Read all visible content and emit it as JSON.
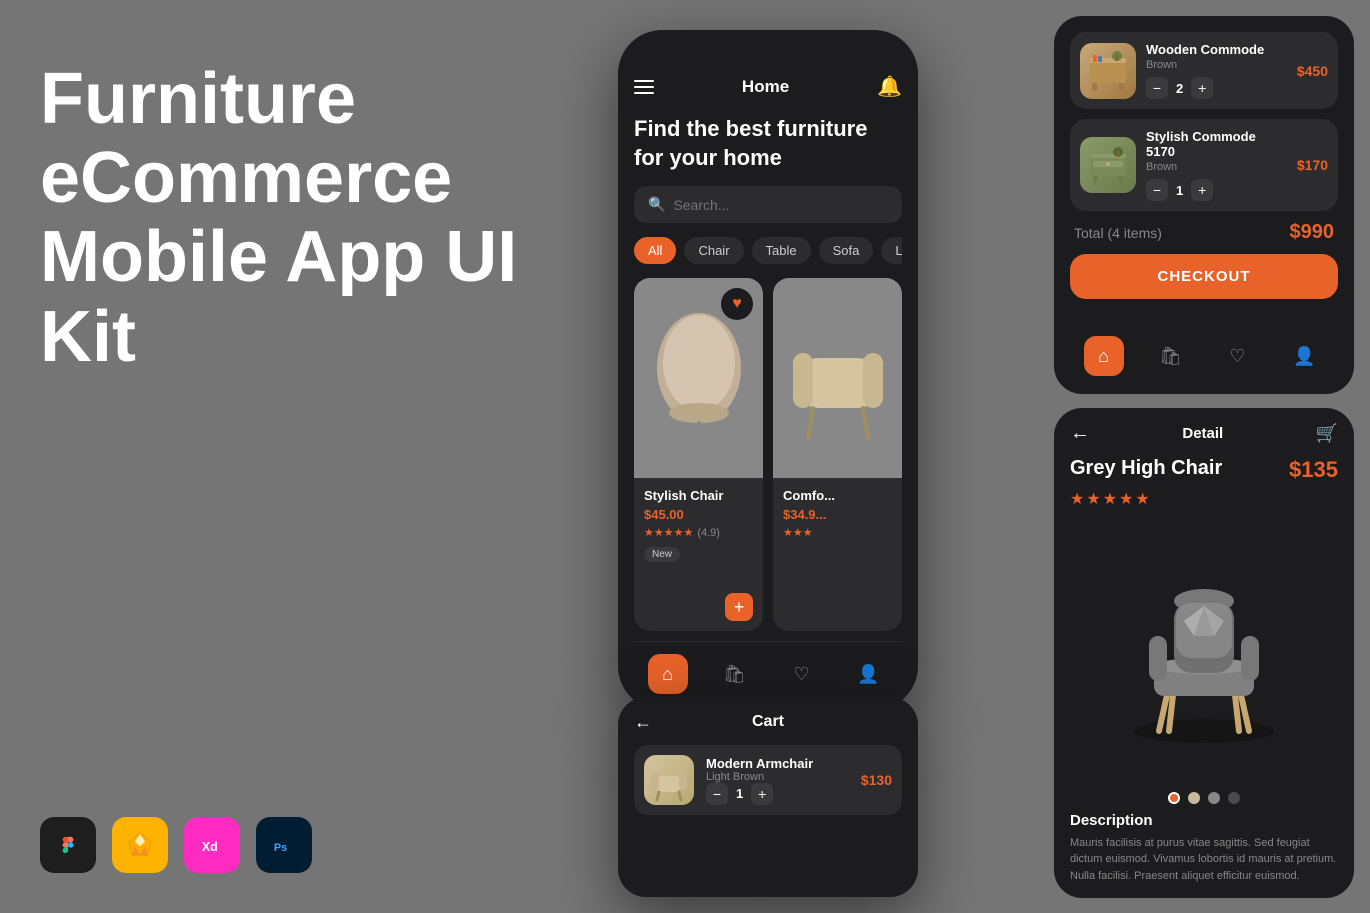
{
  "title": {
    "line1": "Furniture eCommerce",
    "line2": "Mobile App UI Kit"
  },
  "tools": [
    {
      "name": "Figma",
      "symbol": "F",
      "bg": "#1e1e1e",
      "color": "#fff"
    },
    {
      "name": "Sketch",
      "symbol": "S",
      "bg": "#fdb300",
      "color": "#fff"
    },
    {
      "name": "XD",
      "symbol": "Xd",
      "bg": "#ff2bc2",
      "color": "#fff"
    },
    {
      "name": "PS",
      "symbol": "Ps",
      "bg": "#001d34",
      "color": "#31a8ff"
    }
  ],
  "home_screen": {
    "topbar": {
      "title": "Home"
    },
    "headline": "Find the best furniture\nfor your home",
    "search_placeholder": "Search...",
    "categories": [
      "All",
      "Chair",
      "Table",
      "Sofa",
      "Lo..."
    ],
    "products": [
      {
        "name": "Stylish Chair",
        "price": "$45.00",
        "rating": "★★★★★",
        "rating_val": "(4.9)",
        "badge": "New"
      },
      {
        "name": "Comfo...",
        "price": "$34.9...",
        "rating": "★★★",
        "badge": ""
      }
    ],
    "nav_items": [
      "home",
      "bag",
      "heart",
      "person"
    ]
  },
  "checkout_screen": {
    "cart_items": [
      {
        "name": "Wooden Commode",
        "sub": "Brown",
        "qty": "2",
        "price": "$450"
      },
      {
        "name": "Stylish Commode 5170",
        "sub": "Brown",
        "qty": "1",
        "price": "$170"
      }
    ],
    "total_label": "Total (4 items)",
    "total_price": "$990",
    "checkout_btn": "CHECKOUT",
    "nav_items": [
      "home",
      "bag",
      "heart",
      "person"
    ]
  },
  "detail_screen": {
    "title": "Detail",
    "product_name": "Grey High Chair",
    "product_price": "$135",
    "stars": "★★★★★",
    "description_title": "Description",
    "description_text": "Mauris facilisis at purus vitae sagittis. Sed feugiat dictum euismod. Vivamus lobortis id mauris at pretium. Nulla facilisi. Praesent aliquet efficitur euismod.",
    "colors": [
      "#e8622a",
      "#c8b89a",
      "#888888",
      "#4a4a4a"
    ]
  },
  "cart_screen": {
    "title": "Cart",
    "item": {
      "name": "Modern Armchair",
      "sub": "Light Brown",
      "qty": "1",
      "price": "$130"
    }
  }
}
